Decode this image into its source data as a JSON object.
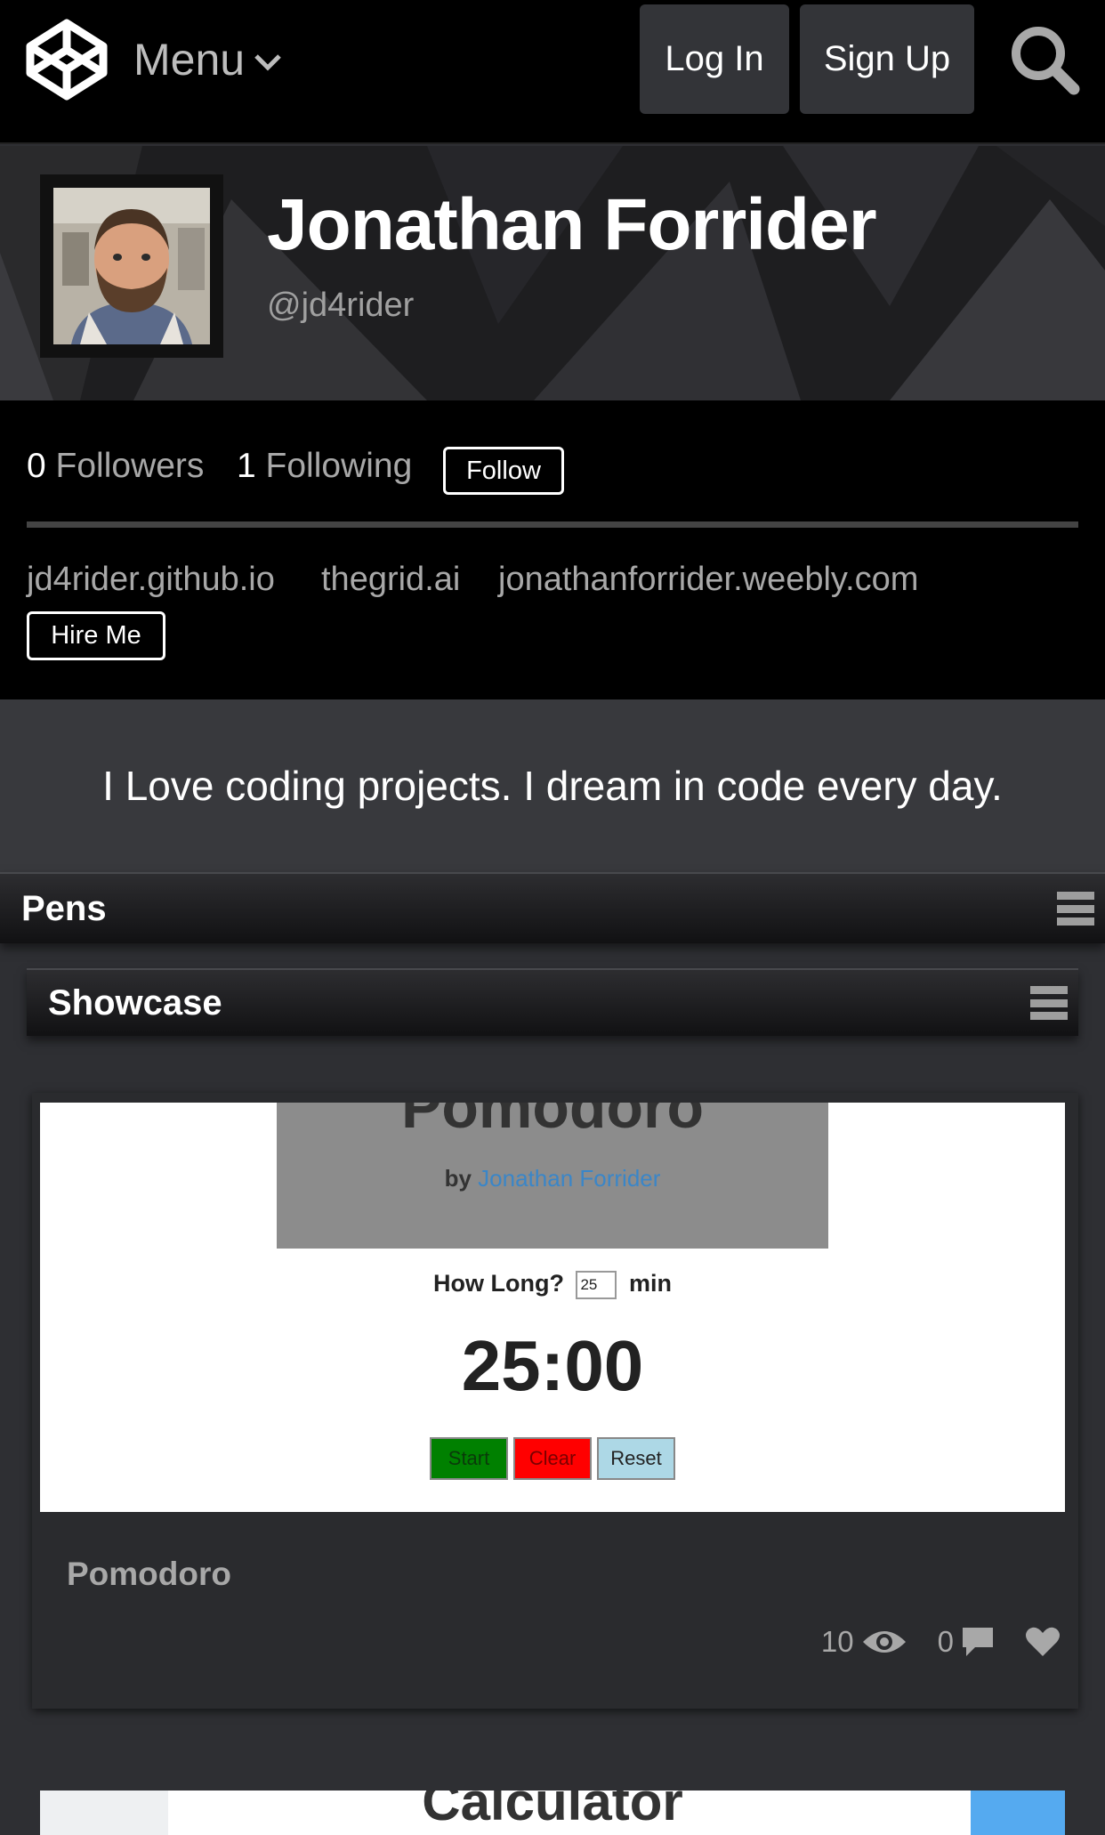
{
  "nav": {
    "menu_label": "Menu",
    "login_label": "Log In",
    "signup_label": "Sign Up"
  },
  "profile": {
    "name": "Jonathan Forrider",
    "handle": "@jd4rider",
    "followers_count": "0",
    "followers_label": "Followers",
    "following_count": "1",
    "following_label": "Following",
    "follow_label": "Follow",
    "links": [
      "jd4rider.github.io",
      "thegrid.ai",
      "jonathanforrider.weebly.com"
    ],
    "hire_label": "Hire Me",
    "bio": "I Love coding projects. I dream in code every day."
  },
  "sections": {
    "pens_title": "Pens",
    "showcase_title": "Showcase"
  },
  "pen": {
    "preview": {
      "title": "Pomodoro",
      "by_label": "by",
      "author": "Jonathan Forrider",
      "how_long_label": "How Long?",
      "minutes_value": "25",
      "min_label": "min",
      "timer": "25:00",
      "start_label": "Start",
      "clear_label": "Clear",
      "reset_label": "Reset"
    },
    "title": "Pomodoro",
    "views": "10",
    "comments": "0"
  },
  "next_pen": {
    "preview_title": "Calculator"
  },
  "colors": {
    "nav_bg": "#000000",
    "page_bg": "#2e2f33",
    "start_green": "#008000",
    "clear_red": "#ff0000",
    "reset_blue": "#add8e6",
    "author_link": "#3a86c8"
  }
}
